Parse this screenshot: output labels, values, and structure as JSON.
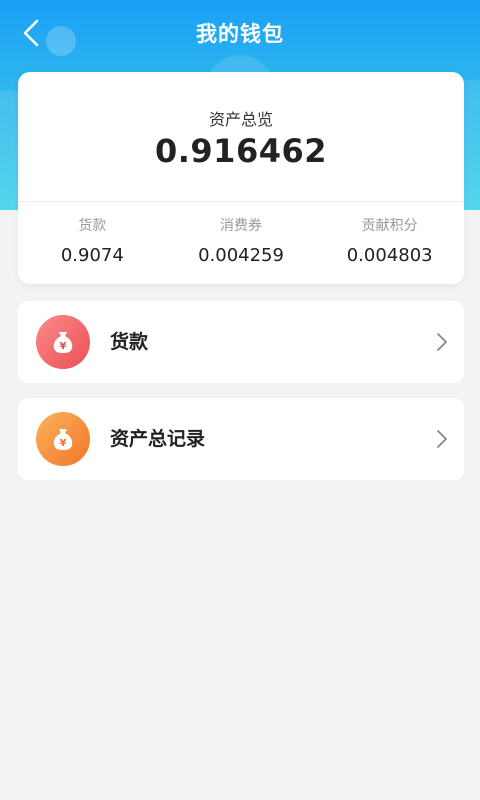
{
  "header": {
    "title": "我的钱包",
    "back_icon": "chevron-left-icon"
  },
  "summary": {
    "label": "资产总览",
    "total": "0.916462",
    "stats": [
      {
        "label": "货款",
        "value": "0.9074"
      },
      {
        "label": "消费券",
        "value": "0.004259"
      },
      {
        "label": "贡献积分",
        "value": "0.004803"
      }
    ]
  },
  "menu": [
    {
      "label": "货款",
      "icon": "money-bag-icon",
      "icon_color": "#ea4f56"
    },
    {
      "label": "资产总记录",
      "icon": "money-bag-icon",
      "icon_color": "#f2742c"
    }
  ],
  "colors": {
    "header_gradient_top": "#1aa0f5",
    "header_gradient_bottom": "#40d2ea",
    "page_background": "#f2f3f5"
  }
}
